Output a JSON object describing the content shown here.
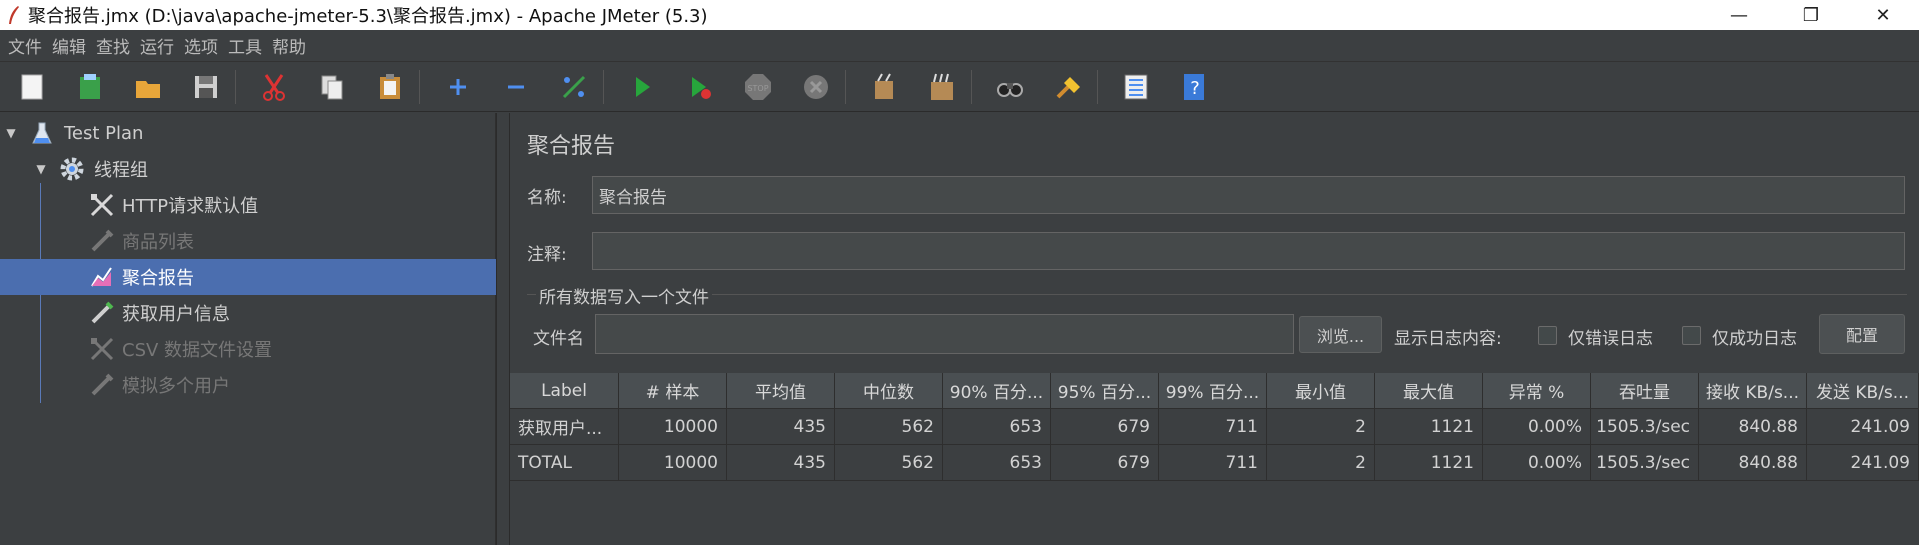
{
  "window": {
    "title": "聚合报告.jmx (D:\\java\\apache-jmeter-5.3\\聚合报告.jmx) - Apache JMeter (5.3)",
    "minimize": "—",
    "maximize": "❐",
    "close": "✕"
  },
  "menu": [
    "文件",
    "编辑",
    "查找",
    "运行",
    "选项",
    "工具",
    "帮助"
  ],
  "toolbar": {
    "icons": [
      "new-icon",
      "templates-icon",
      "open-icon",
      "save-icon",
      "cut-icon",
      "copy-icon",
      "paste-icon",
      "expand-icon",
      "collapse-icon",
      "toggle-icon",
      "start-icon",
      "start-no-pause-icon",
      "stop-icon",
      "shutdown-icon",
      "clear-icon",
      "clear-all-icon",
      "search-icon",
      "reset-search-icon",
      "function-helper-icon",
      "help-icon"
    ]
  },
  "tree": {
    "items": [
      {
        "label": "Test Plan",
        "icon": "test-plan-icon",
        "level": 0,
        "expanded": true,
        "disabled": false,
        "selected": false
      },
      {
        "label": "线程组",
        "icon": "thread-group-gear-icon",
        "level": 1,
        "expanded": true,
        "disabled": false,
        "selected": false
      },
      {
        "label": "HTTP请求默认值",
        "icon": "config-element-icon",
        "level": 2,
        "disabled": false,
        "selected": false
      },
      {
        "label": "商品列表",
        "icon": "sampler-pipette-icon",
        "level": 2,
        "disabled": true,
        "selected": false
      },
      {
        "label": "聚合报告",
        "icon": "listener-report-icon",
        "level": 2,
        "disabled": false,
        "selected": true
      },
      {
        "label": "获取用户信息",
        "icon": "sampler-pipette-icon",
        "level": 2,
        "disabled": false,
        "selected": false
      },
      {
        "label": "CSV 数据文件设置",
        "icon": "config-element-icon",
        "level": 2,
        "disabled": true,
        "selected": false
      },
      {
        "label": "模拟多个用户",
        "icon": "sampler-pipette-icon",
        "level": 2,
        "disabled": true,
        "selected": false
      }
    ]
  },
  "panel": {
    "title": "聚合报告",
    "name_label": "名称:",
    "name_value": "聚合报告",
    "comment_label": "注释:",
    "comment_value": "",
    "group_title": "所有数据写入一个文件",
    "filename_label": "文件名",
    "filename_value": "",
    "browse_button": "浏览...",
    "log_content_label": "显示日志内容:",
    "errors_only_label": "仅错误日志",
    "errors_only_checked": false,
    "success_only_label": "仅成功日志",
    "success_only_checked": false,
    "configure_button": "配置"
  },
  "table": {
    "columns": [
      "Label",
      "# 样本",
      "平均值",
      "中位数",
      "90% 百分...",
      "95% 百分...",
      "99% 百分...",
      "最小值",
      "最大值",
      "异常 %",
      "吞吐量",
      "接收 KB/s...",
      "发送 KB/s..."
    ],
    "rows": [
      [
        "获取用户...",
        "10000",
        "435",
        "562",
        "653",
        "679",
        "711",
        "2",
        "1121",
        "0.00%",
        "1505.3/sec",
        "840.88",
        "241.09"
      ],
      [
        "TOTAL",
        "10000",
        "435",
        "562",
        "653",
        "679",
        "711",
        "2",
        "1121",
        "0.00%",
        "1505.3/sec",
        "840.88",
        "241.09"
      ]
    ]
  }
}
